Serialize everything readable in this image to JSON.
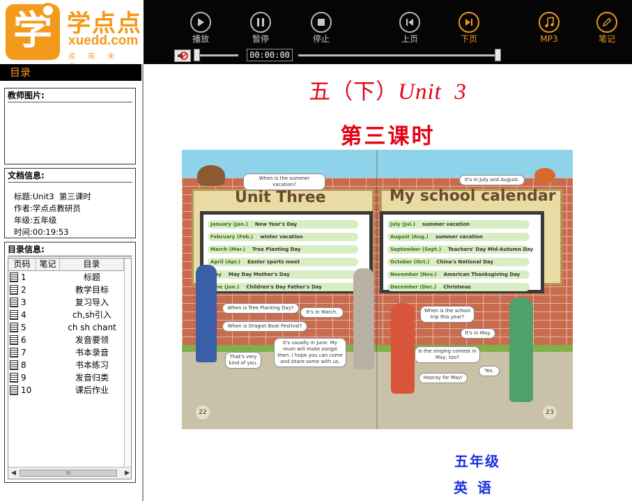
{
  "logo": {
    "cn": "学点点",
    "url": "xuedd.com",
    "slogan": "点亮未来",
    "mark": "学"
  },
  "toolbar": {
    "buttons": [
      {
        "label": "播放",
        "icon": "play-icon"
      },
      {
        "label": "暂停",
        "icon": "pause-icon"
      },
      {
        "label": "停止",
        "icon": "stop-icon"
      },
      {
        "label": "上页",
        "icon": "prev-page-icon"
      },
      {
        "label": "下页",
        "icon": "next-page-icon"
      },
      {
        "label": "MP3",
        "icon": "music-note-icon"
      },
      {
        "label": "笔记",
        "icon": "pencil-icon"
      }
    ],
    "time": "00:00:00",
    "accent_color": "#f29b1d"
  },
  "sidebar": {
    "header": "目录",
    "teacher_panel_title": "教师图片:",
    "doc_panel_title": "文档信息:",
    "doc_info": {
      "title_label": "标题:",
      "title_value": "Unit3  第三课时",
      "author_label": "作者:",
      "author_value": "学点点教研员",
      "grade_label": "年级:",
      "grade_value": "五年级",
      "time_label": "时间:",
      "time_value": "00:19:53"
    },
    "toc_panel_title": "目录信息:",
    "toc_columns": [
      "页码",
      "笔记",
      "目录"
    ],
    "toc_rows": [
      {
        "page": "1",
        "note": "",
        "title": "标题"
      },
      {
        "page": "2",
        "note": "",
        "title": "教学目标"
      },
      {
        "page": "3",
        "note": "",
        "title": "复习导入"
      },
      {
        "page": "4",
        "note": "",
        "title": "ch,sh引入"
      },
      {
        "page": "5",
        "note": "",
        "title": "ch sh chant"
      },
      {
        "page": "6",
        "note": "",
        "title": "发音要领"
      },
      {
        "page": "7",
        "note": "",
        "title": "书本录音"
      },
      {
        "page": "8",
        "note": "",
        "title": "书本练习"
      },
      {
        "page": "9",
        "note": "",
        "title": "发音归类"
      },
      {
        "page": "10",
        "note": "",
        "title": "课后作业"
      }
    ],
    "hscroll_grip": "III"
  },
  "main": {
    "title_prefix": "五（下）",
    "title_unit": "Unit  3",
    "subtitle": "第三课时",
    "grade": "五年级",
    "subject": "英语",
    "title_color": "#e60012",
    "footer_color": "#1a2fe0"
  },
  "scene": {
    "left_heading": "Unit Three",
    "right_heading": "My school calendar",
    "left_months": [
      {
        "month": "January (Jan.)",
        "events": "New Year's Day"
      },
      {
        "month": "February (Feb.)",
        "events": "winter vacation"
      },
      {
        "month": "March (Mar.)",
        "events": "Tree Planting Day"
      },
      {
        "month": "April (Apr.)",
        "events": "Easter   sports meet"
      },
      {
        "month": "May",
        "events": "May Day   Mother's Day"
      },
      {
        "month": "June (Jun.)",
        "events": "Children's Day   Father's Day"
      }
    ],
    "right_months": [
      {
        "month": "July (Jul.)",
        "events": "summer vacation"
      },
      {
        "month": "August (Aug.)",
        "events": "summer vacation"
      },
      {
        "month": "September (Sept.)",
        "events": "Teachers' Day   Mid-Autumn Day"
      },
      {
        "month": "October (Oct.)",
        "events": "China's National Day"
      },
      {
        "month": "November (Nov.)",
        "events": "American Thanksgiving Day"
      },
      {
        "month": "December (Dec.)",
        "events": "Christmas"
      }
    ],
    "bubbles": {
      "b1": "When is the summer vacation?",
      "b2": "It's in July and August.",
      "b3": "When is Tree Planting Day?",
      "b4": "It's in March.",
      "b5": "When is Dragon Boat Festival?",
      "b6": "It's usually in June. My mum will make zongzi then. I hope you can come and share some with us.",
      "b7": "That's very kind of you.",
      "b8": "When is the school trip this year?",
      "b9": "It's in May.",
      "b10": "Is the singing contest in May, too?",
      "b11": "Yes.",
      "b12": "Hooray for May!"
    },
    "page_left": "22",
    "page_right": "23"
  }
}
